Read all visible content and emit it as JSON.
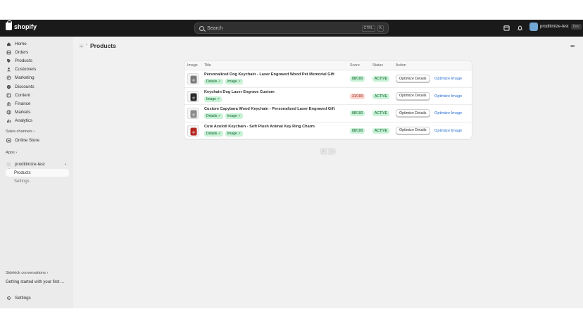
{
  "topbar": {
    "brand": "shopify",
    "search_placeholder": "Search",
    "shortcut_ctrl": "CTRL",
    "shortcut_key": "K",
    "store_name": "proditimize-test",
    "store_badge": "Dev"
  },
  "sidebar": {
    "nav": [
      {
        "label": "Home",
        "icon": "home-icon"
      },
      {
        "label": "Orders",
        "icon": "orders-icon"
      },
      {
        "label": "Products",
        "icon": "tag-icon"
      },
      {
        "label": "Customers",
        "icon": "person-icon"
      },
      {
        "label": "Marketing",
        "icon": "target-icon"
      },
      {
        "label": "Discounts",
        "icon": "discount-icon"
      },
      {
        "label": "Content",
        "icon": "content-icon"
      },
      {
        "label": "Finance",
        "icon": "bank-icon"
      },
      {
        "label": "Markets",
        "icon": "globe-icon"
      },
      {
        "label": "Analytics",
        "icon": "chart-icon"
      }
    ],
    "sales_channels_label": "Sales channels",
    "online_store_label": "Online Store",
    "apps_label": "Apps",
    "app_name": "proditimize-test",
    "app_sub": [
      "Products",
      "Settings"
    ],
    "sidekick_label": "Sidekick conversations",
    "sidekick_item": "Getting started with your first ...",
    "settings_label": "Settings"
  },
  "main": {
    "title": "Products",
    "table": {
      "headers": [
        "Image",
        "Title",
        "Score",
        "Status",
        "Action"
      ],
      "rows": [
        {
          "title": "Personalized Dog Keychain - Laser Engraved Wood Pet Memorial Gift",
          "tags": [
            "Details ✓",
            "Image ✓"
          ],
          "score": "88/100",
          "score_level": "good",
          "status": "ACTIVE",
          "button": "Optimize Details",
          "link": "Optimize Image",
          "thumb_color": "#7a7a7a"
        },
        {
          "title": "Keychain Dog Laser Engrave Custom",
          "tags": [
            "Image ✓"
          ],
          "score": "31/100",
          "score_level": "bad",
          "status": "ACTIVE",
          "button": "Optimize Details",
          "link": "Optimize Image",
          "thumb_color": "#2b2b2b"
        },
        {
          "title": "Custom Capybara Wood Keychain - Personalized Laser Engraved Gift",
          "tags": [
            "Details ✓",
            "Image ✓"
          ],
          "score": "88/100",
          "score_level": "good",
          "status": "ACTIVE",
          "button": "Optimize Details",
          "link": "Optimize Image",
          "thumb_color": "#8a8a8a"
        },
        {
          "title": "Cute Axolotl Keychain - Soft Plush Animal Key Ring Charm",
          "tags": [
            "Details ✓",
            "Image ✓"
          ],
          "score": "88/100",
          "score_level": "good",
          "status": "ACTIVE",
          "button": "Optimize Details",
          "link": "Optimize Image",
          "thumb_color": "#b3261e"
        }
      ]
    },
    "pager_prev": "‹",
    "pager_next": "›"
  }
}
